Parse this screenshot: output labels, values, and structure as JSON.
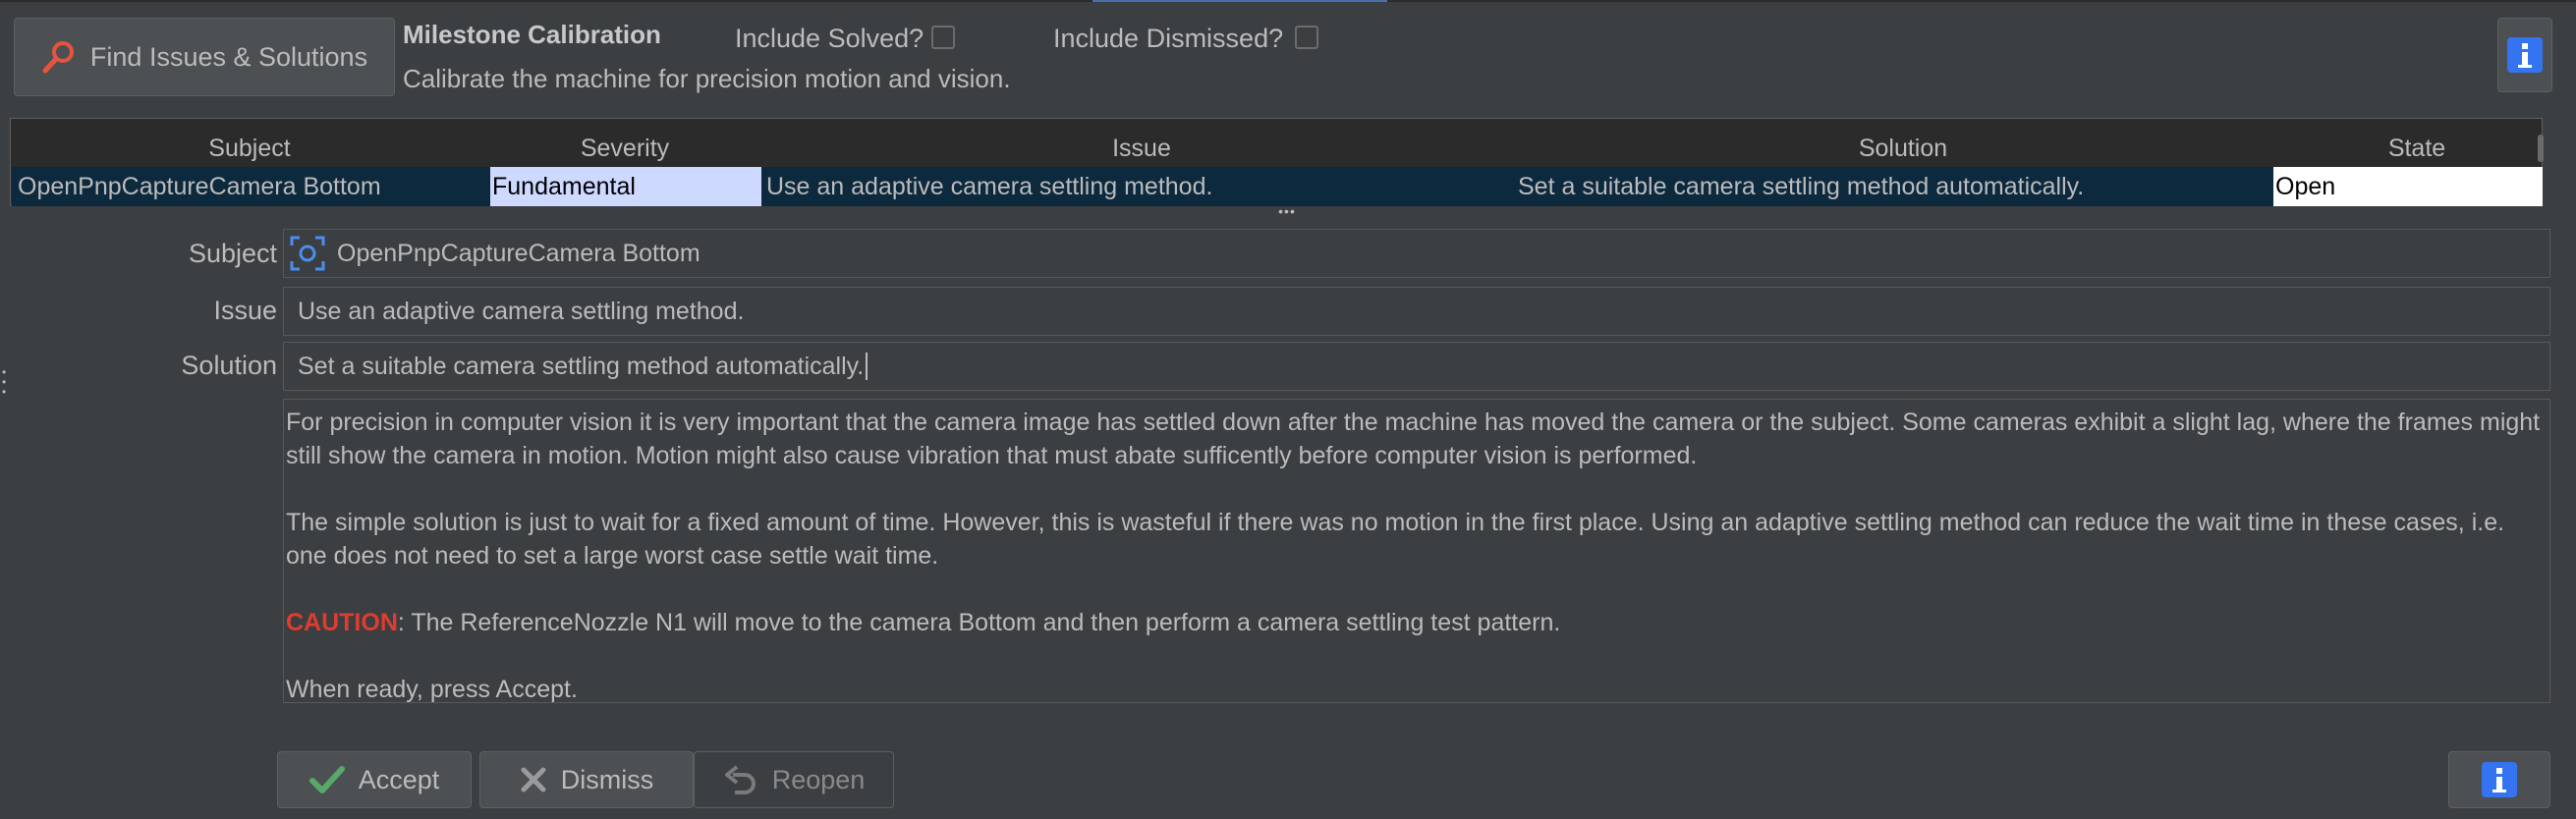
{
  "toolbar": {
    "find_label": "Find Issues & Solutions",
    "milestone_title": "Milestone Calibration",
    "milestone_desc": "Calibrate the machine for precision motion and vision.",
    "include_solved_label": "Include Solved?",
    "include_dismissed_label": "Include Dismissed?",
    "include_solved": false,
    "include_dismissed": false
  },
  "table": {
    "columns": [
      "Subject",
      "Severity",
      "Issue",
      "Solution",
      "State"
    ],
    "rows": [
      {
        "subject": "OpenPnpCaptureCamera Bottom",
        "severity": "Fundamental",
        "issue": "Use an adaptive camera settling method.",
        "solution": "Set a suitable camera settling method automatically.",
        "state": "Open"
      }
    ]
  },
  "detail": {
    "subject_label": "Subject",
    "subject_value": "OpenPnpCaptureCamera Bottom",
    "issue_label": "Issue",
    "issue_value": "Use an adaptive camera settling method.",
    "solution_label": "Solution",
    "solution_value": "Set a suitable camera settling method automatically.",
    "description": {
      "p1": "For precision in computer vision it is very important that the camera image has settled down after the machine has moved the camera or the subject. Some cameras exhibit a slight lag, where the frames might still show the camera in motion. Motion might also cause vibration that must abate sufficently before computer vision is performed.",
      "p2": "The simple solution is just to wait for a fixed amount of time. However, this is wasteful if there was no motion in the first place. Using an adaptive settling method can reduce the wait time in these cases, i.e. one does not need to set a large worst case settle wait time.",
      "caution_word": "CAUTION",
      "caution_rest": ": The ReferenceNozzle N1 will move to the camera Bottom and then perform a camera settling test pattern.",
      "p4": "When ready, press Accept."
    }
  },
  "actions": {
    "accept_label": "Accept",
    "dismiss_label": "Dismiss",
    "reopen_label": "Reopen"
  },
  "colors": {
    "background": "#3c3f41",
    "selection_row": "#0d293e",
    "severity_highlight": "#cdd9ff",
    "caution": "#e03c2f",
    "accept_icon": "#59a869",
    "info_icon": "#3574f0"
  }
}
